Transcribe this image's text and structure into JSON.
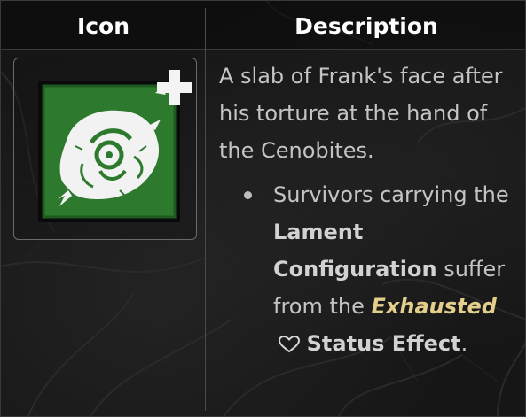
{
  "table": {
    "headers": {
      "icon": "Icon",
      "description": "Description"
    }
  },
  "addon": {
    "icon_name": "frank-face-slab-icon",
    "plus_badge": "plus-icon",
    "colors": {
      "background_green": "#2d7a2e",
      "art": "#f2f2f2"
    }
  },
  "description": {
    "flavor_text": "A slab of Frank's face after his torture at the hand of the Cenobites.",
    "bullet": {
      "text_1": "Survivors carrying the",
      "item_name": "Lament Configuration",
      "text_2": "suffer from the",
      "status_name": "Exhausted",
      "status_icon": "heart-outline-icon",
      "status_suffix": "Status Effect",
      "end": "."
    }
  },
  "colors": {
    "status_keyword": "#e3cf8b",
    "body_text": "#c4c4c4",
    "header_text": "#ffffff"
  }
}
